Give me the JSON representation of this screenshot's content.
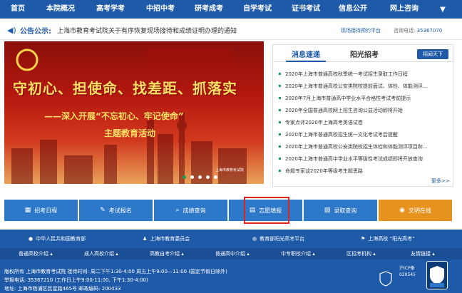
{
  "nav": {
    "items": [
      "首页",
      "本院概况",
      "高考学考",
      "中招中考",
      "研考成考",
      "自学考试",
      "证书考试",
      "信息公开",
      "网上咨询"
    ]
  },
  "notice": {
    "label": "公告公示:",
    "text": "上海市教育考试院关于有序恢复现场接待和成绩证明办理的通知",
    "reservation": "现场接待预约平台",
    "phone_label": "咨询电话:",
    "phone": "35367070"
  },
  "banner": {
    "line1": "守初心、担使命、找差距、抓落实",
    "line2": "——深入开展“不忘初心、牢记使命”",
    "line3": "主题教育活动",
    "org": "上海市教育考试院"
  },
  "news": {
    "tabs": [
      "消息速递",
      "阳光招考"
    ],
    "more_button": "招闻天下",
    "items": [
      "2020年上海市普通高校秋季统一考试招生录取工作日程",
      "2020年上海市普通高校公安类院校提前面试、体检、体能测评...",
      "2020年7月上海市普通高中学业水平合格性考试考前提示",
      "2020年全国普通高校网上招生咨询公益活动即将开始",
      "专家点评2020年上海高考英语试卷",
      "2020年上海市普通高校招生统一文化考试考后提醒",
      "2020年上海市普通高校公安类院校招生体检和体能测评项目和...",
      "2020年上海市普通高中学业水平等级性考试成绩即将开放查询",
      "命题专家谈2020年等级考生题思路"
    ],
    "more_link": "更多>>"
  },
  "quick": [
    {
      "icon": "calendar-icon",
      "glyph": "▦",
      "label": "招考日程"
    },
    {
      "icon": "pen-icon",
      "glyph": "✎",
      "label": "考试报名"
    },
    {
      "icon": "search-icon",
      "glyph": "⌕",
      "label": "成绩查询"
    },
    {
      "icon": "form-icon",
      "glyph": "▤",
      "label": "志愿填报"
    },
    {
      "icon": "document-icon",
      "glyph": "▧",
      "label": "录取查询"
    },
    {
      "icon": "chat-icon",
      "glyph": "◉",
      "label": "文明在线"
    }
  ],
  "links": [
    {
      "icon": "emblem-icon",
      "label": "中华人民共和国教育部"
    },
    {
      "icon": "person-icon",
      "label": "上海市教育委员会"
    },
    {
      "icon": "globe-icon",
      "label": "教育部阳光高考平台"
    },
    {
      "icon": "flag-icon",
      "label": "上海高校 “阳光高考”"
    }
  ],
  "sub_nav": [
    "普通高校介绍 ▴",
    "成人高校介绍 ▴",
    "高教自考介绍 ▴",
    "普通高中介绍 ▴",
    "中专职校介绍 ▴",
    "区招考机构 ▴",
    "友情链接 ▴"
  ],
  "footer": {
    "line1": "版权所有  上海市教育考试院  接待时间: 周二下午1:30-4:00  周五上午9:00—11:00 (国定节假日除外)",
    "line2": "举报电话: 35367210  (工作日上午9:00-11:00, 下午1:30-4:00)",
    "line3": "地址: 上海市杨浦区民星路465号  邮政编码: 200433",
    "icp": "沪ICP备\n020545"
  },
  "colors": {
    "primary": "#1e5aa8",
    "quick_button": "#2d78c8",
    "quick_accent": "#e6921e",
    "highlight": "#e0251b",
    "bullet": "#1aa053"
  }
}
